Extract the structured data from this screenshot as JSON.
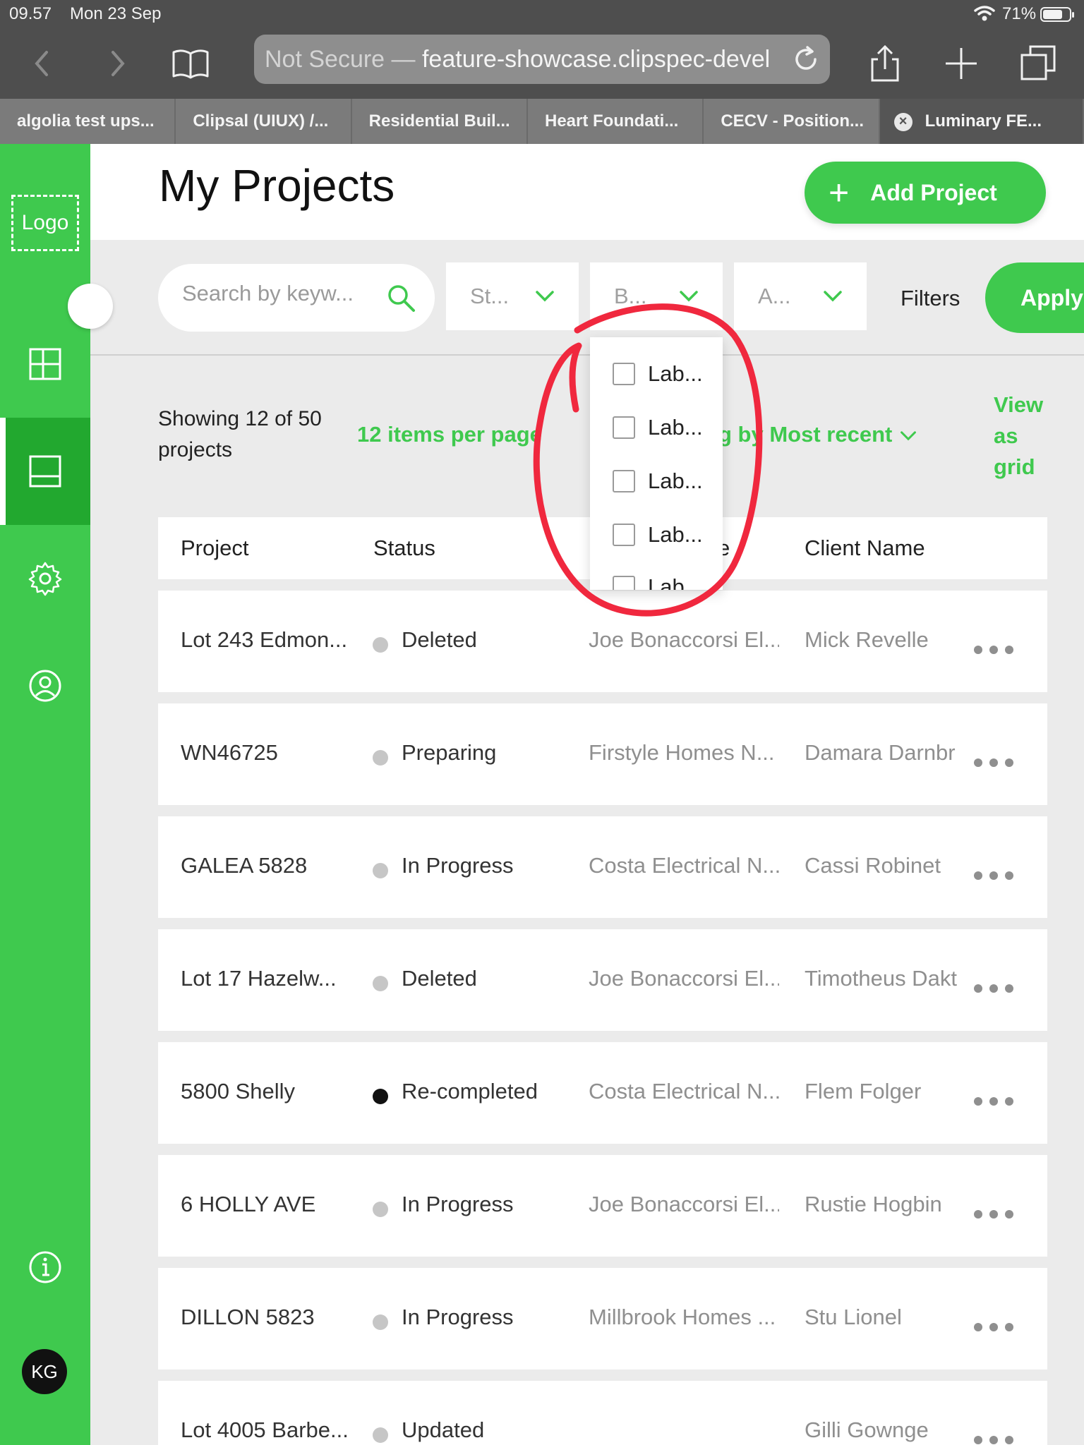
{
  "status_bar": {
    "time": "09.57",
    "date": "Mon 23 Sep",
    "battery": "71%"
  },
  "browser": {
    "url_prefix": "Not Secure —",
    "url": "feature-showcase.clipspec-devel",
    "tabs": [
      {
        "label": "algolia test ups..."
      },
      {
        "label": "Clipsal (UIUX) /..."
      },
      {
        "label": "Residential Buil..."
      },
      {
        "label": "Heart Foundati..."
      },
      {
        "label": "CECV - Position..."
      },
      {
        "label": "Luminary FE...",
        "active": true
      }
    ]
  },
  "sidebar": {
    "logo": "Logo",
    "items": [
      "dashboard-icon",
      "projects-icon",
      "settings-icon",
      "account-icon",
      "info-icon"
    ],
    "avatar": "KG",
    "accent": "#3fc94e"
  },
  "header": {
    "title": "My Projects",
    "add_button": "Add Project"
  },
  "filters": {
    "search_placeholder": "Search by keyw...",
    "status_dropdown": "St...",
    "builder_dropdown": "B...",
    "assignee_dropdown": "A...",
    "label": "Filters",
    "apply": "Apply"
  },
  "dropdown_options": [
    "Lab...",
    "Lab...",
    "Lab...",
    "Lab...",
    "Lab"
  ],
  "listing": {
    "showing": "Showing 12 of 50 projects",
    "per_page": "12 items per page",
    "sort_prefix": "g by",
    "sort": "Most recent",
    "view_as_grid": "View as grid"
  },
  "table": {
    "columns": [
      "Project",
      "Status",
      "e",
      "Client Name"
    ],
    "rows": [
      {
        "project": "Lot 243 Edmon...",
        "status": "Deleted",
        "builder": "Joe Bonaccorsi El...",
        "client": "Mick Revelle"
      },
      {
        "project": "WN46725",
        "status": "Preparing",
        "builder": "Firstyle Homes N...",
        "client": "Damara Darnbr"
      },
      {
        "project": "GALEA 5828",
        "status": "In Progress",
        "builder": "Costa Electrical N...",
        "client": "Cassi Robinet"
      },
      {
        "project": "Lot 17 Hazelw...",
        "status": "Deleted",
        "builder": "Joe Bonaccorsi El...",
        "client": "Timotheus Dakt"
      },
      {
        "project": "5800 Shelly",
        "status": "Re-completed",
        "builder": "Costa Electrical N...",
        "client": "Flem Folger"
      },
      {
        "project": "6 HOLLY AVE",
        "status": "In Progress",
        "builder": "Joe Bonaccorsi El...",
        "client": "Rustie Hogbin"
      },
      {
        "project": "DILLON 5823",
        "status": "In Progress",
        "builder": "Millbrook Homes ...",
        "client": "Stu Lionel"
      },
      {
        "project": "Lot 4005 Barbe...",
        "status": "Updated",
        "builder": "",
        "client": "Gilli Gownge"
      }
    ]
  }
}
